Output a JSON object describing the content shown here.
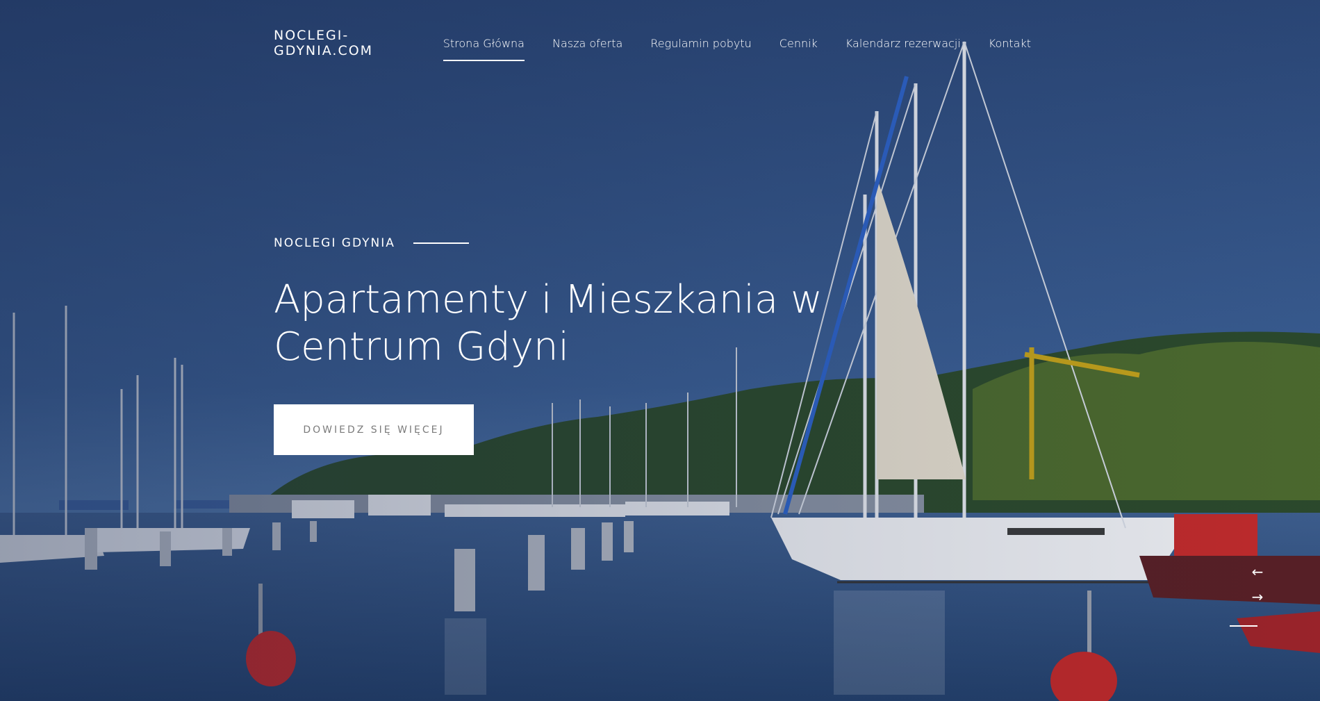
{
  "header": {
    "logo": "NOCLEGI-GDYNIA.COM",
    "nav": [
      {
        "label": "Strona Główna",
        "active": true
      },
      {
        "label": "Nasza oferta",
        "active": false
      },
      {
        "label": "Regulamin pobytu",
        "active": false
      },
      {
        "label": "Cennik",
        "active": false
      },
      {
        "label": "Kalendarz rezerwacji",
        "active": false
      },
      {
        "label": "Kontakt",
        "active": false
      }
    ]
  },
  "hero": {
    "eyebrow": "NOCLEGI GDYNIA",
    "headline": "Apartamenty i Mieszkania w Centrum Gdyni",
    "cta_label": "DOWIEDZ SIĘ WIĘCEJ"
  },
  "slider": {
    "prev_icon": "arrow-left-icon",
    "next_icon": "arrow-right-icon"
  },
  "colors": {
    "sky_top": "#2c4a7c",
    "water": "#2f4f80",
    "cta_bg": "#ffffff",
    "cta_text": "#7b7b7b"
  }
}
